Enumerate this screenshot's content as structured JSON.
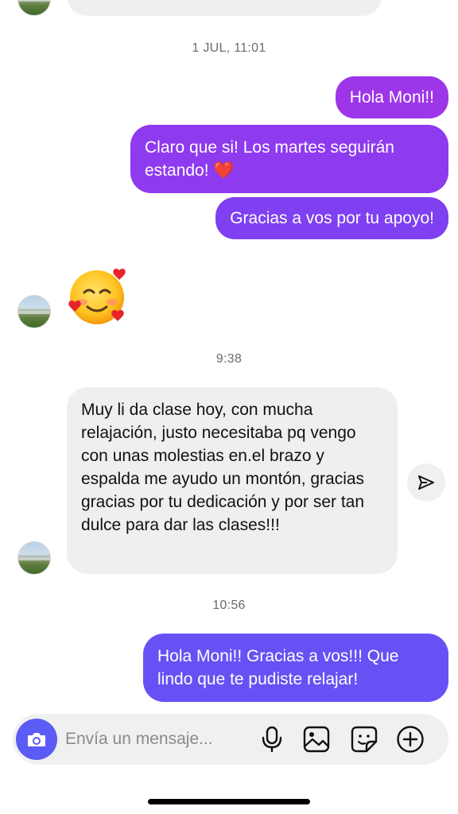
{
  "conversation": {
    "timestamps": [
      "1 JUL, 11:01",
      "9:38",
      "10:56"
    ],
    "outgoing_1": [
      "Hola Moni!!",
      "Claro que si! Los martes seguirán estando! ❤️",
      "Gracias a vos por tu apoyo!"
    ],
    "incoming_message": "Muy li da clase hoy, con mucha relajación, justo necesitaba pq vengo con unas molestias en.el brazo y espalda me ayudo un montón, gracias gracias por tu dedicación y por ser tan dulce para dar las clases!!!",
    "outgoing_2": "Hola Moni!! Gracias a vos!!! Que lindo que te pudiste relajar!"
  },
  "composer": {
    "placeholder": "Envía un mensaje..."
  },
  "icons": [
    "camera-icon",
    "microphone-icon",
    "gallery-icon",
    "sticker-icon",
    "add-icon",
    "send-icon",
    "smiling-face-with-hearts-emoji"
  ],
  "colors": {
    "outgoing_purple": "#9d35e9",
    "outgoing_violet": "#7f40f1",
    "outgoing_indigo": "#6652f4",
    "incoming_bubble": "#efefef",
    "camera_button": "#5b5bf5"
  }
}
